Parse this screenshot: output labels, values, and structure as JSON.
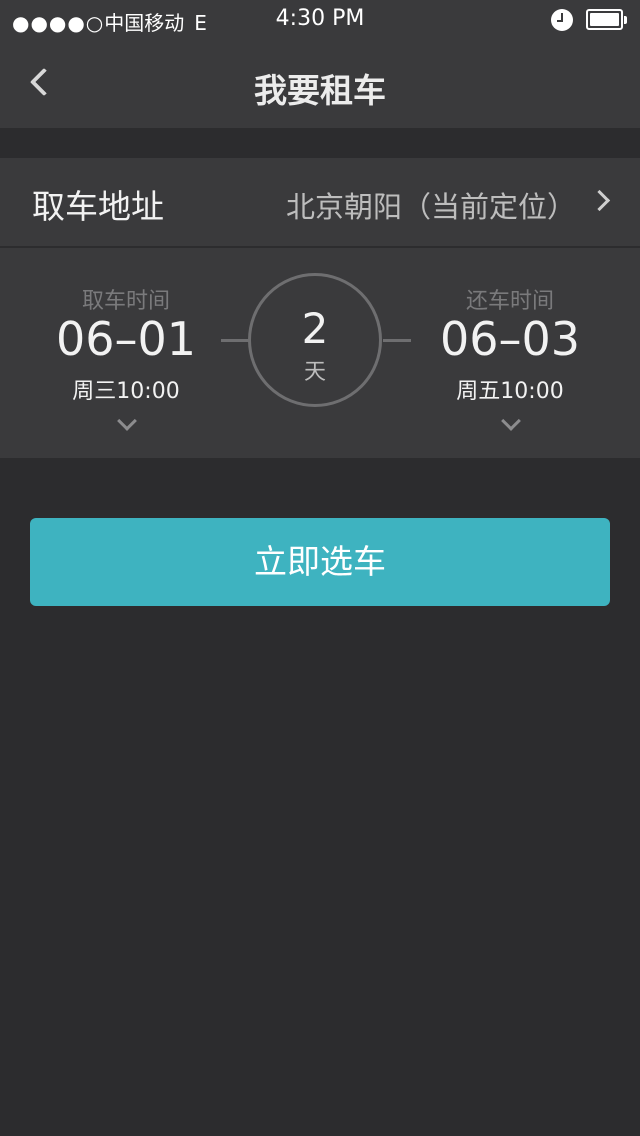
{
  "status_bar": {
    "signal": "●●●●○",
    "carrier": "中国移动",
    "network": "E",
    "time": "4:30 PM",
    "alarm_icon": "alarm-clock-icon",
    "battery_icon": "battery-full-icon"
  },
  "nav": {
    "back_icon": "chevron-left-icon",
    "title": "我要租车"
  },
  "address": {
    "label": "取车地址",
    "value": "北京朝阳（当前定位）",
    "chevron_icon": "chevron-right-icon"
  },
  "pickup": {
    "caption": "取车时间",
    "date": "06–01",
    "day_time": "周三10:00"
  },
  "duration": {
    "number": "2",
    "unit": "天"
  },
  "return": {
    "caption": "还车时间",
    "date": "06–03",
    "day_time": "周五10:00"
  },
  "action": {
    "label": "立即选车"
  },
  "colors": {
    "nav_background": "#3a3a3c",
    "page_background": "#2c2c2e",
    "accent": "#3eb3c0"
  }
}
